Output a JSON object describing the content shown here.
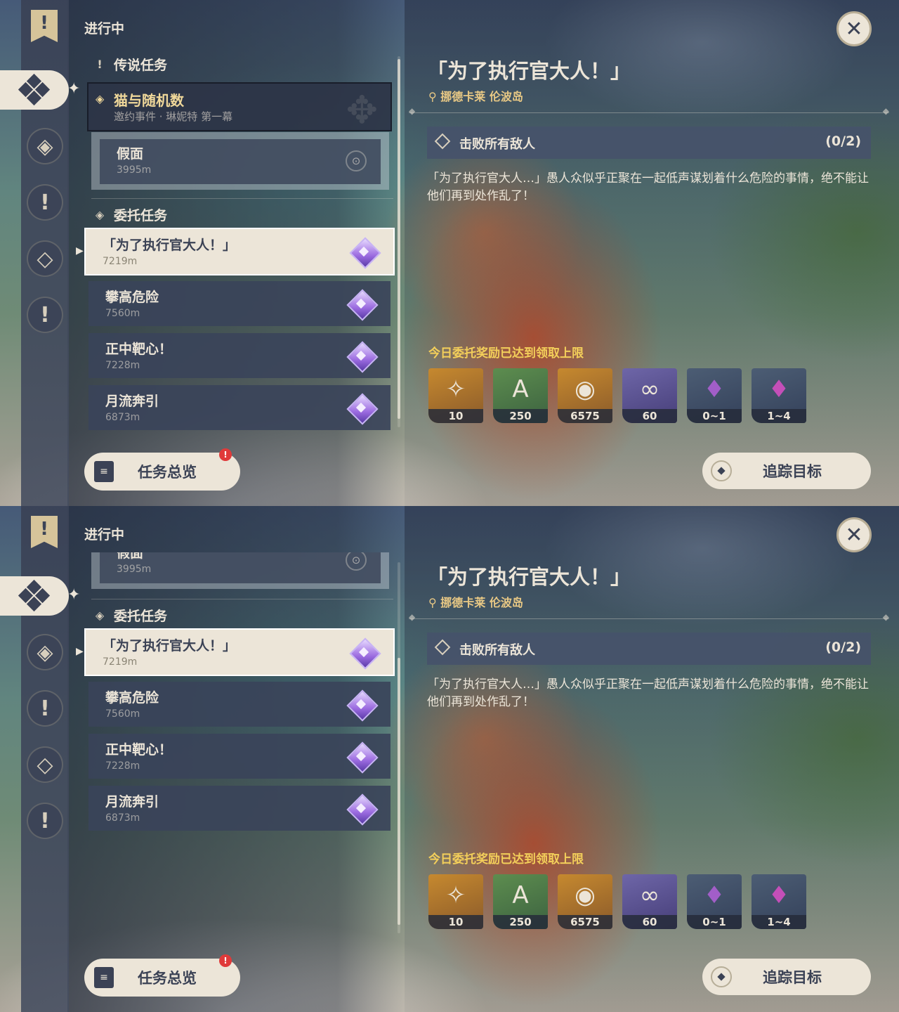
{
  "status": "进行中",
  "archon_section": "传说任务",
  "archon_quest": {
    "title": "猫与随机数",
    "subtitle": "邀约事件 · 琳妮特 第一幕"
  },
  "sub_step": {
    "title": "假面",
    "distance": "3995m"
  },
  "commission_section": "委托任务",
  "commissions": [
    {
      "title": "「为了执行官大人！」",
      "distance": "7219m"
    },
    {
      "title": "攀高危险",
      "distance": "7560m"
    },
    {
      "title": "正中靶心！",
      "distance": "7228m"
    },
    {
      "title": "月流奔引",
      "distance": "6873m"
    }
  ],
  "detail": {
    "title": "「为了执行官大人！」",
    "location": "挪德卡莱 伦波岛",
    "objective": "击败所有敌人",
    "progress": "(0/2)",
    "description": "「为了执行官大人…」愚人众似乎正聚在一起低声谋划着什么危险的事情，绝不能让他们再到处作乱了！",
    "reward_note": "今日委托奖励已达到领取上限",
    "rewards": [
      {
        "icon": "primogem-icon",
        "count": "10"
      },
      {
        "icon": "adventure-exp-icon",
        "count": "250"
      },
      {
        "icon": "mora-icon",
        "count": "6575"
      },
      {
        "icon": "companionship-exp-icon",
        "count": "60"
      },
      {
        "icon": "crystal-ore-icon",
        "count": "0~1"
      },
      {
        "icon": "purple-crystal-icon",
        "count": "1~4"
      }
    ]
  },
  "buttons": {
    "overview": "任务总览",
    "overview_badge": "!",
    "track": "追踪目标"
  }
}
